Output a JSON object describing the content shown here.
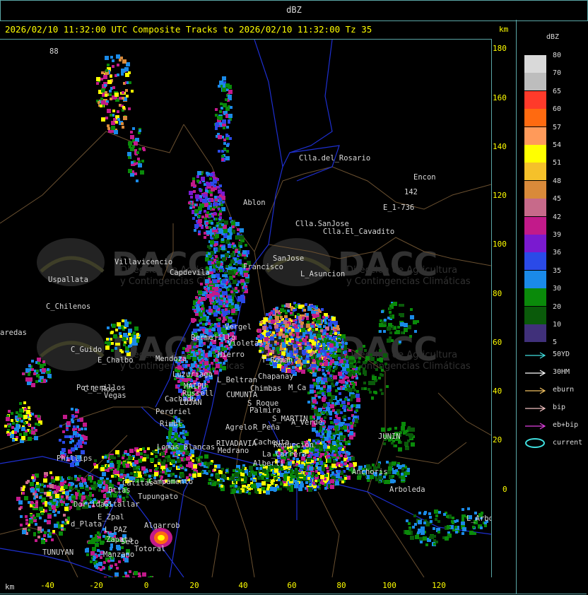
{
  "header": {
    "title": "dBZ"
  },
  "subtitle": "2026/02/10 11:32:00 UTC Composite Tracks to 2026/02/10 11:32:00 Tz 35",
  "units": {
    "top_right": "km",
    "bottom_left": "km"
  },
  "axes": {
    "y_ticks": [
      "180",
      "160",
      "140",
      "120",
      "100",
      "80",
      "60",
      "40",
      "20",
      "0"
    ],
    "x_ticks": [
      "-40",
      "-20",
      "0",
      "20",
      "40",
      "60",
      "80",
      "100",
      "120"
    ]
  },
  "legend": {
    "title": "dBZ",
    "scale": [
      {
        "label": "80",
        "color": "#d9d9d9"
      },
      {
        "label": "70",
        "color": "#bdbdbd"
      },
      {
        "label": "65",
        "color": "#ff3a2a"
      },
      {
        "label": "60",
        "color": "#ff6a10"
      },
      {
        "label": "57",
        "color": "#ff9a5a"
      },
      {
        "label": "54",
        "color": "#ffff00"
      },
      {
        "label": "51",
        "color": "#f5c12a"
      },
      {
        "label": "48",
        "color": "#d98a3a"
      },
      {
        "label": "45",
        "color": "#c76a8a"
      },
      {
        "label": "42",
        "color": "#c21a8a"
      },
      {
        "label": "39",
        "color": "#7a1ad0"
      },
      {
        "label": "36",
        "color": "#2a4ae8"
      },
      {
        "label": "35",
        "color": "#1a8ae8"
      },
      {
        "label": "30",
        "color": "#0a8a0a"
      },
      {
        "label": "20",
        "color": "#0a5a0a"
      },
      {
        "label": "10",
        "color": "#40307a"
      },
      {
        "label": "5",
        "color": "#40307a"
      }
    ],
    "tracks": [
      {
        "label": "50YD",
        "color": "#40e0e0"
      },
      {
        "label": "30HM",
        "color": "#ffffff"
      },
      {
        "label": "eburn",
        "color": "#f0c060"
      },
      {
        "label": "bip",
        "color": "#f0c0c0"
      },
      {
        "label": "eb+bip",
        "color": "#e040e0"
      },
      {
        "label": "current",
        "color": "#40e0e0"
      }
    ]
  },
  "watermark": {
    "brand": "DACC",
    "line1": "Dirección de Agricultura",
    "line2": "y Contingencias Climáticas"
  },
  "places": [
    "Clla.del_Rosario",
    "Encon",
    "142",
    "E_1-736",
    "Clla.SanJose",
    "Clla.El_Cavadito",
    "Ablon",
    "SanJose",
    "L_Asuncion",
    "Villavicencio",
    "Capdevila",
    "Francisco",
    "Uspallata",
    "C_Chilenos",
    "aredas",
    "Vergel",
    "Bermejillo",
    "Violetas",
    "C_Guido",
    "E_Chalbo",
    "Mendoza",
    "Hierro",
    "T_Roman",
    "Chapanay",
    "M_Ca",
    "L_Beltran",
    "Chimbas",
    "Luzuriaga",
    "MAIPU",
    "Russell",
    "Potrerillos",
    "Vegas",
    "Cachadu",
    "LUJAN",
    "CUMUNTA",
    "S_Roque",
    "Palmira",
    "S_MARTIN",
    "Perdriel",
    "A_Verde",
    "Rimbl",
    "Agrelo",
    "R_Peña",
    "JUNIN",
    "Lomas_Blancas",
    "Cacheuta",
    "RIVADAVIA",
    "Medrano",
    "Reducción",
    "Phillips",
    "La_Carrera",
    "Alberti",
    "Campamento",
    "Anchoris",
    "Catitas",
    "Btias",
    "Tupungato",
    "Arboleda",
    "Dorrida",
    "Gitallar",
    "E_Zpal",
    "d_Plata",
    "L_Arbols",
    "L_PAZ",
    "Algarrob",
    "Zapata",
    "Seco",
    "Totoral",
    "TUNUYAN",
    "Manzano",
    "C_L_Ros",
    "88"
  ]
}
